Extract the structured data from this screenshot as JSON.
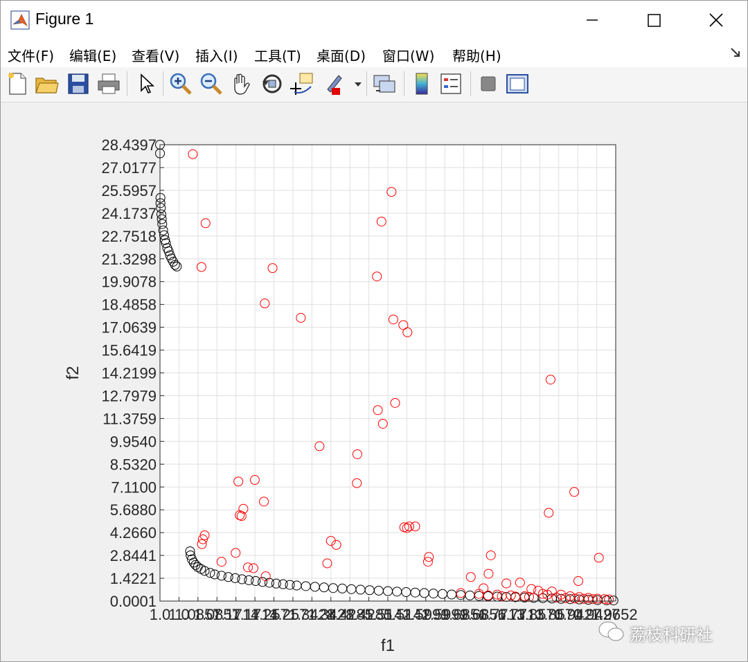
{
  "window": {
    "title": "Figure 1"
  },
  "menu": [
    {
      "label": "文件(F)"
    },
    {
      "label": "编辑(E)"
    },
    {
      "label": "查看(V)"
    },
    {
      "label": "插入(I)"
    },
    {
      "label": "工具(T)"
    },
    {
      "label": "桌面(D)"
    },
    {
      "label": "窗口(W)"
    },
    {
      "label": "帮助(H)"
    }
  ],
  "toolbar": [
    {
      "icon": "new-figure-icon"
    },
    {
      "icon": "open-file-icon"
    },
    {
      "icon": "save-icon"
    },
    {
      "icon": "print-icon"
    },
    {
      "icon": "pointer-icon"
    },
    {
      "icon": "zoom-in-icon"
    },
    {
      "icon": "zoom-out-icon"
    },
    {
      "icon": "pan-icon"
    },
    {
      "icon": "rotate-3d-icon"
    },
    {
      "icon": "data-cursor-icon"
    },
    {
      "icon": "brush-icon"
    },
    {
      "icon": "link-plot-icon"
    },
    {
      "icon": "colorbar-icon"
    },
    {
      "icon": "legend-icon"
    },
    {
      "icon": "hide-plot-tools-icon"
    },
    {
      "icon": "show-plot-tools-icon"
    }
  ],
  "watermark": {
    "text": "荔枝科研社"
  },
  "chart_data": {
    "type": "scatter",
    "xlabel": "f1",
    "ylabel": "f2",
    "xlim": [
      1.0,
      2.0
    ],
    "ylim": [
      0.0001,
      28.4397
    ],
    "grid": true,
    "ytick_labels": [
      "0.0001",
      "1.4221",
      "2.8441",
      "4.2660",
      "5.6880",
      "7.1100",
      "8.5320",
      "9.9540",
      "11.3759",
      "12.7979",
      "14.2199",
      "15.6419",
      "17.0639",
      "18.4858",
      "19.9078",
      "21.3298",
      "22.7518",
      "24.1737",
      "25.5957",
      "27.0177",
      "28.4397"
    ],
    "xtick_labels": [
      "1.0",
      "1.0",
      "1.0857",
      "1.0857",
      "1.1714",
      "1.1714",
      "1.2571",
      "1.2571",
      "1.3428",
      "1.3428",
      "1.4285",
      "1.4285",
      "1.5142",
      "1.5142",
      "1.5999",
      "1.5999",
      "1.6856",
      "1.6856",
      "1.7713",
      "1.7713",
      "1.8570",
      "1.8570",
      "1.9427",
      "1.9427",
      "1.9652"
    ],
    "series": [
      {
        "color": "#000000",
        "marker": "open-circle",
        "points": [
          [
            1.0,
            28.44
          ],
          [
            1.0,
            27.9
          ],
          [
            1.001,
            25.13
          ],
          [
            1.001,
            24.8
          ],
          [
            1.002,
            24.5
          ],
          [
            1.003,
            24.1
          ],
          [
            1.004,
            23.8
          ],
          [
            1.005,
            23.5
          ],
          [
            1.007,
            23.1
          ],
          [
            1.009,
            22.8
          ],
          [
            1.011,
            22.5
          ],
          [
            1.013,
            22.3
          ],
          [
            1.016,
            22.0
          ],
          [
            1.019,
            21.8
          ],
          [
            1.022,
            21.55
          ],
          [
            1.025,
            21.35
          ],
          [
            1.029,
            21.15
          ],
          [
            1.033,
            20.95
          ],
          [
            1.037,
            20.85
          ],
          [
            1.066,
            3.1
          ],
          [
            1.067,
            2.85
          ],
          [
            1.07,
            2.6
          ],
          [
            1.074,
            2.4
          ],
          [
            1.078,
            2.25
          ],
          [
            1.083,
            2.12
          ],
          [
            1.09,
            2.0
          ],
          [
            1.098,
            1.88
          ],
          [
            1.11,
            1.76
          ],
          [
            1.12,
            1.66
          ],
          [
            1.135,
            1.58
          ],
          [
            1.15,
            1.5
          ],
          [
            1.165,
            1.43
          ],
          [
            1.18,
            1.36
          ],
          [
            1.195,
            1.3
          ],
          [
            1.21,
            1.25
          ],
          [
            1.225,
            1.19
          ],
          [
            1.24,
            1.14
          ],
          [
            1.255,
            1.09
          ],
          [
            1.27,
            1.05
          ],
          [
            1.285,
            1.01
          ],
          [
            1.3,
            0.97
          ],
          [
            1.32,
            0.93
          ],
          [
            1.34,
            0.89
          ],
          [
            1.36,
            0.85
          ],
          [
            1.38,
            0.81
          ],
          [
            1.4,
            0.78
          ],
          [
            1.42,
            0.74
          ],
          [
            1.44,
            0.71
          ],
          [
            1.46,
            0.68
          ],
          [
            1.48,
            0.65
          ],
          [
            1.5,
            0.62
          ],
          [
            1.52,
            0.59
          ],
          [
            1.54,
            0.56
          ],
          [
            1.56,
            0.53
          ],
          [
            1.58,
            0.5
          ],
          [
            1.6,
            0.47
          ],
          [
            1.62,
            0.44
          ],
          [
            1.64,
            0.41
          ],
          [
            1.66,
            0.38
          ],
          [
            1.68,
            0.35
          ],
          [
            1.7,
            0.32
          ],
          [
            1.72,
            0.3
          ],
          [
            1.74,
            0.28
          ],
          [
            1.76,
            0.26
          ],
          [
            1.78,
            0.24
          ],
          [
            1.8,
            0.22
          ],
          [
            1.82,
            0.2
          ],
          [
            1.84,
            0.18
          ],
          [
            1.86,
            0.16
          ],
          [
            1.88,
            0.14
          ],
          [
            1.9,
            0.12
          ],
          [
            1.92,
            0.1
          ],
          [
            1.94,
            0.08
          ],
          [
            1.96,
            0.06
          ],
          [
            1.98,
            0.05
          ],
          [
            1.995,
            0.04
          ]
        ]
      },
      {
        "color": "#ff0000",
        "marker": "open-circle",
        "points": [
          [
            1.072,
            27.85
          ],
          [
            1.1,
            23.55
          ],
          [
            1.091,
            20.82
          ],
          [
            1.247,
            20.75
          ],
          [
            1.23,
            18.55
          ],
          [
            1.309,
            17.65
          ],
          [
            1.476,
            20.23
          ],
          [
            1.486,
            23.65
          ],
          [
            1.508,
            25.5
          ],
          [
            1.512,
            17.55
          ],
          [
            1.534,
            17.2
          ],
          [
            1.543,
            16.75
          ],
          [
            1.478,
            11.9
          ],
          [
            1.489,
            11.05
          ],
          [
            1.516,
            12.35
          ],
          [
            1.35,
            9.65
          ],
          [
            1.433,
            9.15
          ],
          [
            1.432,
            7.35
          ],
          [
            1.172,
            7.45
          ],
          [
            1.208,
            7.55
          ],
          [
            1.228,
            6.2
          ],
          [
            1.183,
            5.75
          ],
          [
            1.175,
            5.35
          ],
          [
            1.179,
            5.3
          ],
          [
            1.092,
            3.55
          ],
          [
            1.094,
            3.85
          ],
          [
            1.098,
            4.1
          ],
          [
            1.166,
            3.0
          ],
          [
            1.375,
            3.75
          ],
          [
            1.387,
            3.5
          ],
          [
            1.367,
            2.35
          ],
          [
            1.536,
            4.6
          ],
          [
            1.542,
            4.55
          ],
          [
            1.547,
            4.65
          ],
          [
            1.56,
            4.65
          ],
          [
            1.59,
            2.75
          ],
          [
            1.588,
            2.45
          ],
          [
            1.135,
            2.45
          ],
          [
            1.193,
            2.1
          ],
          [
            1.205,
            2.05
          ],
          [
            1.232,
            1.55
          ],
          [
            1.682,
            1.5
          ],
          [
            1.721,
            1.7
          ],
          [
            1.726,
            2.85
          ],
          [
            1.71,
            0.8
          ],
          [
            1.76,
            1.1
          ],
          [
            1.79,
            1.15
          ],
          [
            1.84,
            0.45
          ],
          [
            1.85,
            0.4
          ],
          [
            1.857,
            13.8
          ],
          [
            1.853,
            5.5
          ],
          [
            1.909,
            6.8
          ],
          [
            1.918,
            1.25
          ],
          [
            1.963,
            2.7
          ],
          [
            1.66,
            0.5
          ],
          [
            1.7,
            0.45
          ],
          [
            1.74,
            0.4
          ],
          [
            1.77,
            0.35
          ],
          [
            1.8,
            0.3
          ],
          [
            1.815,
            0.75
          ],
          [
            1.83,
            0.65
          ],
          [
            1.86,
            0.6
          ],
          [
            1.88,
            0.4
          ],
          [
            1.9,
            0.3
          ],
          [
            1.92,
            0.25
          ],
          [
            1.94,
            0.2
          ],
          [
            1.96,
            0.15
          ],
          [
            1.975,
            0.12
          ],
          [
            1.985,
            0.1
          ],
          [
            1.72,
            0.35
          ],
          [
            1.75,
            0.3
          ],
          [
            1.78,
            0.28
          ],
          [
            1.81,
            0.26
          ],
          [
            1.87,
            0.22
          ],
          [
            1.89,
            0.18
          ],
          [
            1.91,
            0.16
          ],
          [
            1.93,
            0.14
          ],
          [
            1.95,
            0.12
          ]
        ]
      }
    ]
  }
}
